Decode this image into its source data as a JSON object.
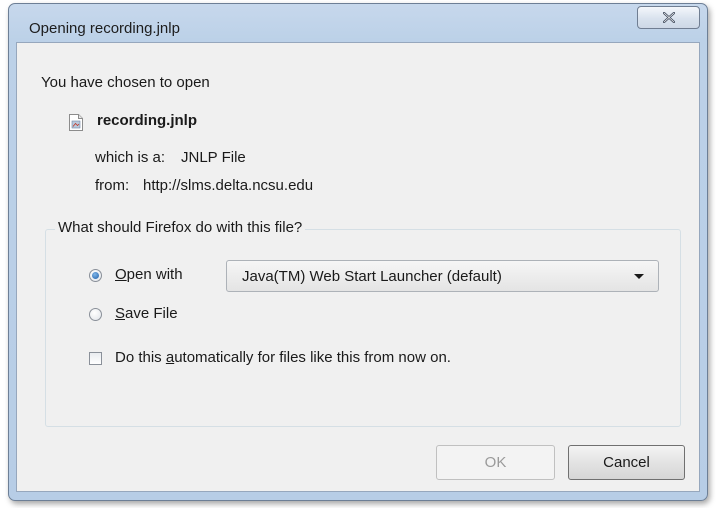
{
  "window": {
    "title": "Opening recording.jnlp"
  },
  "dialog": {
    "intro": "You have chosen to open",
    "file_name": "recording.jnlp",
    "which_is_label": "which is a:",
    "which_is_value": "JNLP File",
    "from_label": "from:",
    "from_value": "http://slms.delta.ncsu.edu",
    "group_title": "What should Firefox do with this file?",
    "open_with": {
      "mnemonic": "O",
      "rest": "pen with",
      "selected": true
    },
    "open_with_app": "Java(TM) Web Start Launcher (default)",
    "save_file": {
      "mnemonic": "S",
      "rest": "ave File",
      "selected": false
    },
    "auto": {
      "before": "Do this ",
      "mnemonic": "a",
      "after": "utomatically for files like this from now on.",
      "checked": false
    }
  },
  "buttons": {
    "ok": "OK",
    "cancel": "Cancel"
  },
  "icons": {
    "close": "close-icon",
    "file": "jnlp-file-icon",
    "dropdown": "chevron-down-icon"
  }
}
